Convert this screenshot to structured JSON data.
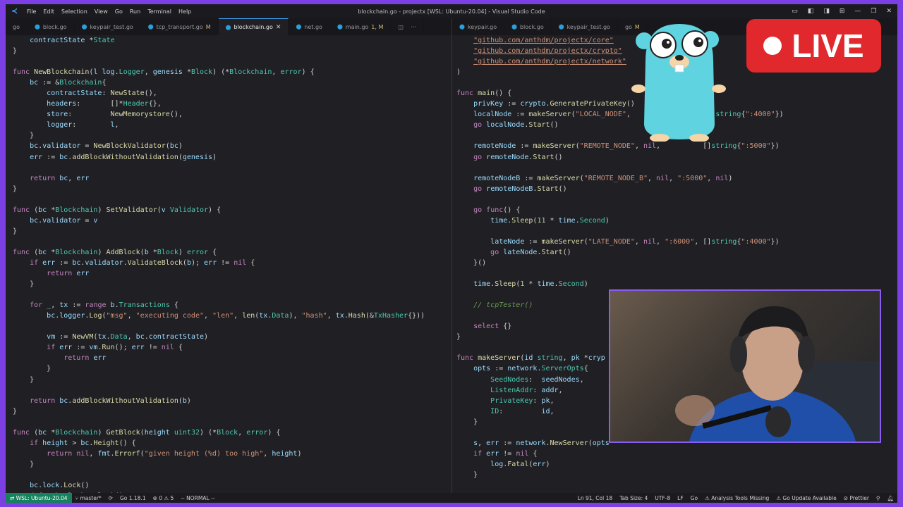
{
  "titlebar": {
    "app_icon": "vscode-icon",
    "menu": [
      "File",
      "Edit",
      "Selection",
      "View",
      "Go",
      "Run",
      "Terminal",
      "Help"
    ],
    "title": "blockchain.go - projectx [WSL: Ubuntu-20.04] - Visual Studio Code",
    "controls": [
      "layout-icons",
      "minimize-icon",
      "restore-icon",
      "close-icon"
    ]
  },
  "tabs_left": [
    {
      "label": "go",
      "dot": false,
      "mod": ""
    },
    {
      "label": "block.go",
      "dot": true,
      "mod": ""
    },
    {
      "label": "keypair_test.go",
      "dot": true,
      "mod": ""
    },
    {
      "label": "tcp_transport.go",
      "dot": true,
      "mod": "M"
    },
    {
      "label": "blockchain.go",
      "dot": true,
      "mod": "",
      "active": true
    },
    {
      "label": "net.go",
      "dot": true,
      "mod": ""
    },
    {
      "label": "main.go",
      "dot": true,
      "mod": "1, M"
    }
  ],
  "tabs_right": [
    {
      "label": "keypair.go",
      "dot": true,
      "mod": ""
    },
    {
      "label": "block.go",
      "dot": true,
      "mod": ""
    },
    {
      "label": "keypair_test.go",
      "dot": true,
      "mod": ""
    },
    {
      "label": "go",
      "dot": false,
      "mod": "M"
    }
  ],
  "editor_left_lines": [
    "    contractState *State",
    "}",
    "",
    "func NewBlockchain(l log.Logger, genesis *Block) (*Blockchain, error) {",
    "    bc := &Blockchain{",
    "        contractState: NewState(),",
    "        headers:       []*Header{},",
    "        store:         NewMemorystore(),",
    "        logger:        l,",
    "    }",
    "    bc.validator = NewBlockValidator(bc)",
    "    err := bc.addBlockWithoutValidation(genesis)",
    "",
    "    return bc, err",
    "}",
    "",
    "func (bc *Blockchain) SetValidator(v Validator) {",
    "    bc.validator = v",
    "}",
    "",
    "func (bc *Blockchain) AddBlock(b *Block) error {",
    "    if err := bc.validator.ValidateBlock(b); err != nil {",
    "        return err",
    "    }",
    "",
    "    for _, tx := range b.Transactions {",
    "        bc.logger.Log(\"msg\", \"executing code\", \"len\", len(tx.Data), \"hash\", tx.Hash(&TxHasher{}))",
    "",
    "        vm := NewVM(tx.Data, bc.contractState)",
    "        if err := vm.Run(); err != nil {",
    "            return err",
    "        }",
    "    }",
    "",
    "    return bc.addBlockWithoutValidation(b)",
    "}",
    "",
    "func (bc *Blockchain) GetBlock(height uint32) (*Block, error) {",
    "    if height > bc.Height() {",
    "        return nil, fmt.Errorf(\"given height (%d) too high\", height)",
    "    }",
    "",
    "    bc.lock.Lock()",
    "    defer bc.lock.Unlock()"
  ],
  "editor_right_lines": [
    "    \"github.com/anthdm/projectx/core\"",
    "    \"github.com/anthdm/projectx/crypto\"",
    "    \"github.com/anthdm/projectx/network\"",
    ")",
    "",
    "func main() {",
    "    privKey := crypto.GeneratePrivateKey()",
    "    localNode := makeServer(\"LOCAL_NODE\",                  []string{\":4000\"})",
    "    go localNode.Start()",
    "",
    "    remoteNode := makeServer(\"REMOTE_NODE\", nil,          []string{\":5000\"})",
    "    go remoteNode.Start()",
    "",
    "    remoteNodeB := makeServer(\"REMOTE_NODE_B\", nil, \":5000\", nil)",
    "    go remoteNodeB.Start()",
    "",
    "    go func() {",
    "        time.Sleep(11 * time.Second)",
    "",
    "        lateNode := makeServer(\"LATE_NODE\", nil, \":6000\", []string{\":4000\"})",
    "        go lateNode.Start()",
    "    }()",
    "",
    "    time.Sleep(1 * time.Second)",
    "",
    "    // tcpTester()",
    "",
    "    select {}",
    "}",
    "",
    "func makeServer(id string, pk *cryp",
    "    opts := network.ServerOpts{",
    "        SeedNodes:  seedNodes,",
    "        ListenAddr: addr,",
    "        PrivateKey: pk,",
    "        ID:         id,",
    "    }",
    "",
    "    s, err := network.NewServer(opts",
    "    if err != nil {",
    "        log.Fatal(err)",
    "    }",
    "",
    "    return s"
  ],
  "statusbar": {
    "remote": "WSL: Ubuntu-20.04",
    "branch": "master*",
    "go_version": "Go 1.18.1",
    "problems": "⊗ 0 ⚠ 5",
    "mode": "-- NORMAL --",
    "position": "Ln 91, Col 18",
    "tab_size": "Tab Size: 4",
    "encoding": "UTF-8",
    "eol": "LF",
    "language": "Go",
    "analysis": "Analysis Tools Missing",
    "update": "Go Update Available",
    "prettier": "Prettier"
  },
  "live_badge": {
    "text": "LIVE",
    "color": "#e0282d"
  },
  "accent": {
    "frame": "#7b3fe4",
    "webcam_border": "#8a5cf0",
    "remote_bg": "#16825d"
  }
}
